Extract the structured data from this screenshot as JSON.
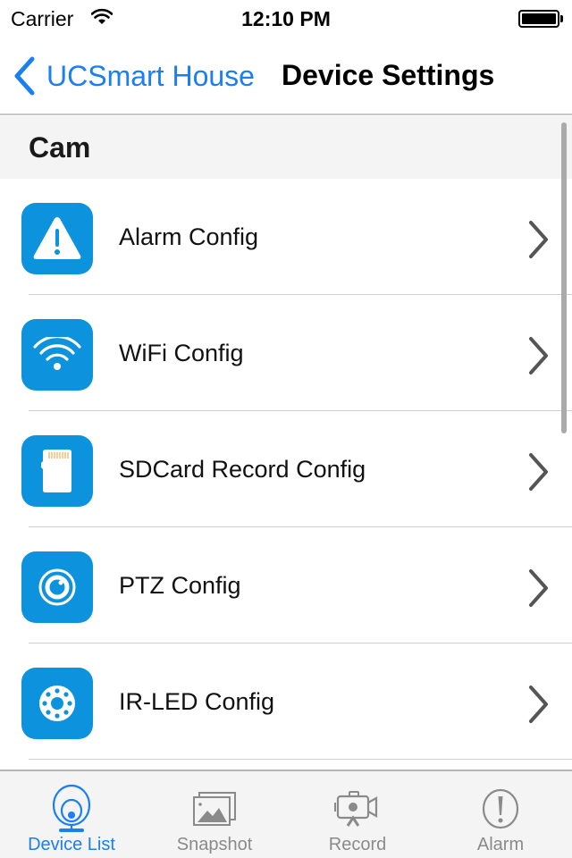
{
  "status_bar": {
    "carrier": "Carrier",
    "time": "12:10 PM",
    "wifi_icon": "wifi-icon",
    "battery_level": 1.0
  },
  "nav": {
    "back_label": "UCSmart House",
    "title": "Device Settings",
    "accent_color": "#1a7ff0"
  },
  "section": {
    "title": "Cam",
    "items": [
      {
        "label": "Alarm Config",
        "icon": "warning-icon"
      },
      {
        "label": "WiFi Config",
        "icon": "wifi-icon"
      },
      {
        "label": "SDCard Record Config",
        "icon": "sdcard-icon"
      },
      {
        "label": "PTZ Config",
        "icon": "ptz-icon"
      },
      {
        "label": "IR-LED Config",
        "icon": "ir-led-icon"
      }
    ]
  },
  "tab_bar": {
    "tabs": [
      {
        "label": "Device List",
        "icon": "webcam-icon",
        "active": true
      },
      {
        "label": "Snapshot",
        "icon": "image-icon",
        "active": false
      },
      {
        "label": "Record",
        "icon": "video-camera-icon",
        "active": false
      },
      {
        "label": "Alarm",
        "icon": "alert-icon",
        "active": false
      }
    ]
  },
  "colors": {
    "icon_bg": "#0d92de",
    "tab_active": "#1a7ff0",
    "tab_inactive": "#8a8a8a"
  }
}
